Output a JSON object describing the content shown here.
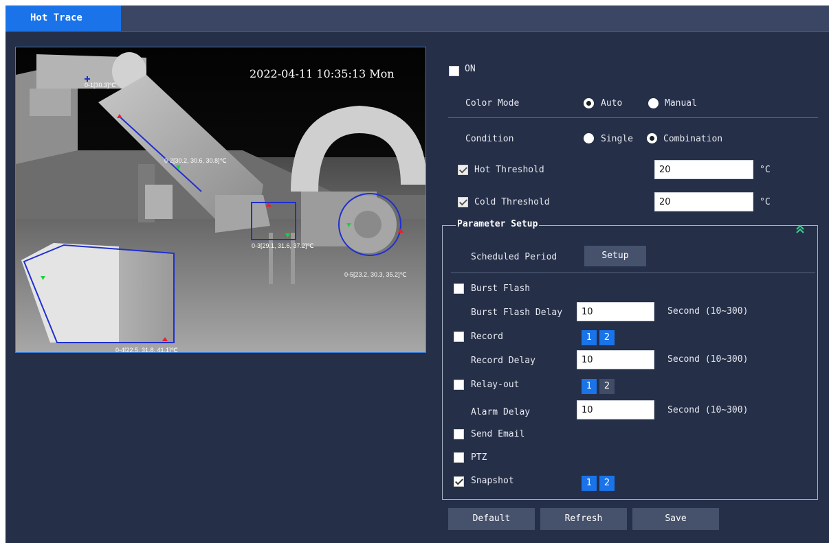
{
  "tab": {
    "label": "Hot Trace"
  },
  "video": {
    "timestamp": "2022-04-11 10:35:13 Mon",
    "markers": [
      {
        "label": "0-1[30.3]℃"
      },
      {
        "label": "0-2[30.2, 30.6, 30.8]℃"
      },
      {
        "label": "0-3[29.1, 31.6, 37.2]℃"
      },
      {
        "label": "0-4[22.5, 31.8, 41.1]℃"
      },
      {
        "label": "0-5[23.2, 30.3, 35.2]℃"
      }
    ]
  },
  "settings": {
    "on": {
      "label": "ON",
      "checked": false
    },
    "color_mode": {
      "label": "Color Mode",
      "options": [
        "Auto",
        "Manual"
      ],
      "selected": "Auto"
    },
    "condition": {
      "label": "Condition",
      "options": [
        "Single",
        "Combination"
      ],
      "selected": "Combination"
    },
    "hot_threshold": {
      "label": "Hot Threshold",
      "value": "20",
      "unit": "°C",
      "checked": true
    },
    "cold_threshold": {
      "label": "Cold Threshold",
      "value": "20",
      "unit": "°C",
      "checked": true
    }
  },
  "parameter_setup": {
    "title": "Parameter Setup",
    "scheduled_period": {
      "label": "Scheduled Period",
      "button": "Setup"
    },
    "burst_flash": {
      "label": "Burst Flash",
      "checked": false
    },
    "burst_flash_delay": {
      "label": "Burst Flash Delay",
      "value": "10",
      "hint": "Second (10~300)"
    },
    "record": {
      "label": "Record",
      "checked": false,
      "channels": [
        "1",
        "2"
      ],
      "active": [
        true,
        true
      ]
    },
    "record_delay": {
      "label": "Record Delay",
      "value": "10",
      "hint": "Second (10~300)"
    },
    "relay_out": {
      "label": "Relay-out",
      "checked": false,
      "channels": [
        "1",
        "2"
      ],
      "active": [
        true,
        false
      ]
    },
    "alarm_delay": {
      "label": "Alarm Delay",
      "value": "10",
      "hint": "Second (10~300)"
    },
    "send_email": {
      "label": "Send Email",
      "checked": false
    },
    "ptz": {
      "label": "PTZ",
      "checked": false
    },
    "snapshot": {
      "label": "Snapshot",
      "checked": true,
      "channels": [
        "1",
        "2"
      ],
      "active": [
        true,
        true
      ]
    }
  },
  "footer": {
    "default": "Default",
    "refresh": "Refresh",
    "save": "Save"
  },
  "colors": {
    "accent": "#1a73e8",
    "background": "#252f48",
    "hot_marker": "#e8202a",
    "cold_marker": "#20d040",
    "overlay": "#1f2fd0"
  },
  "icons": {
    "collapse": "double-chevron-up-icon"
  }
}
